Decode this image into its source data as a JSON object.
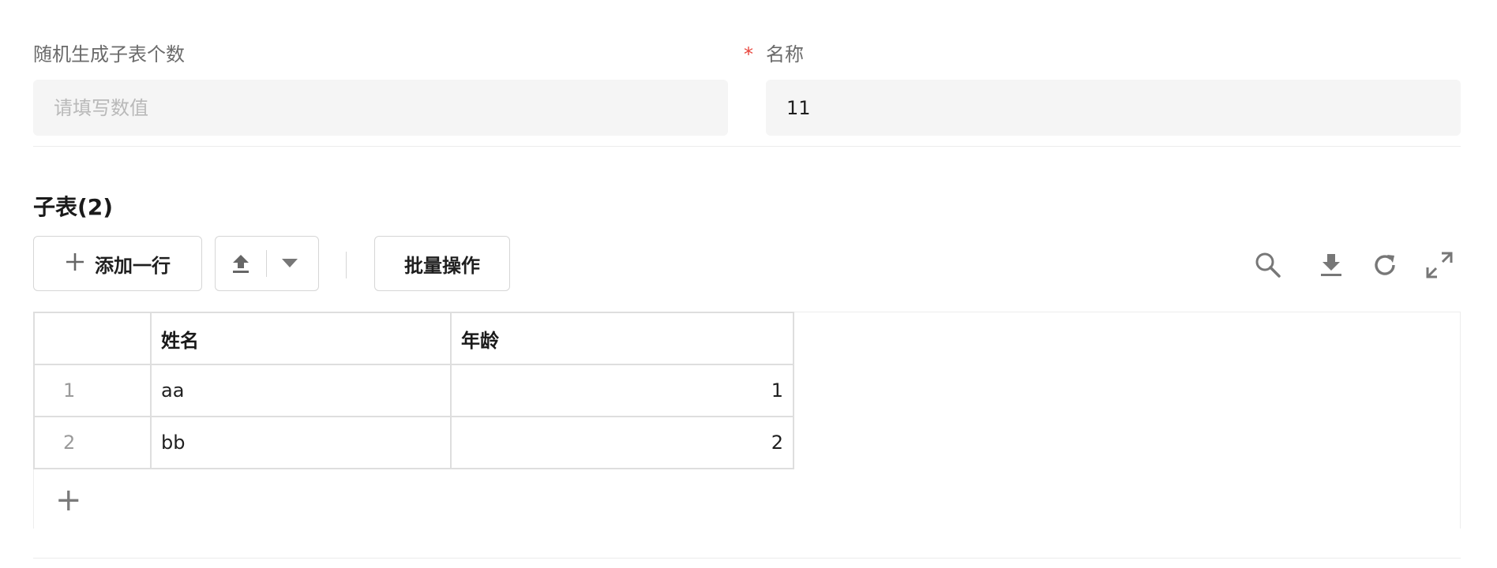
{
  "form": {
    "random_count_label": "随机生成子表个数",
    "random_count_placeholder": "请填写数值",
    "name_required_mark": "*",
    "name_label": "名称",
    "name_value": "11"
  },
  "subtable": {
    "title": "子表(2)",
    "add_row_label": "添加一行",
    "batch_label": "批量操作",
    "add_plus_glyph": "+",
    "columns": [
      "姓名",
      "年龄"
    ],
    "rows": [
      {
        "index": "1",
        "name": "aa",
        "age": "1"
      },
      {
        "index": "2",
        "name": "bb",
        "age": "2"
      }
    ]
  },
  "icons": {
    "toolbar_left": [
      "plus-icon",
      "upload-icon",
      "caret-down-icon"
    ],
    "toolbar_right": [
      "search-icon",
      "download-icon",
      "refresh-icon",
      "fullscreen-icon"
    ]
  },
  "colors": {
    "required": "#e8453c",
    "input_bg": "#f5f5f5",
    "border": "#d6d6d6"
  }
}
